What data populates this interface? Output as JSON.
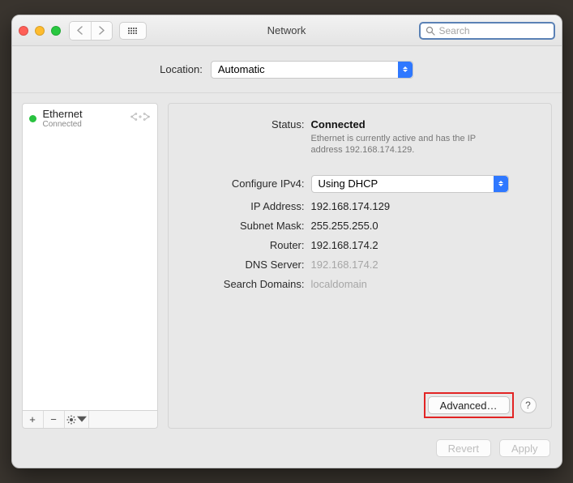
{
  "header": {
    "title": "Network",
    "search_placeholder": "Search"
  },
  "location": {
    "label": "Location:",
    "value": "Automatic"
  },
  "sidebar": {
    "items": [
      {
        "name": "Ethernet",
        "status": "Connected",
        "dot_color": "#29c240"
      }
    ]
  },
  "detail": {
    "status_label": "Status:",
    "status_value": "Connected",
    "status_description": "Ethernet is currently active and has the IP address 192.168.174.129.",
    "configure_label": "Configure IPv4:",
    "configure_value": "Using DHCP",
    "ip_label": "IP Address:",
    "ip_value": "192.168.174.129",
    "subnet_label": "Subnet Mask:",
    "subnet_value": "255.255.255.0",
    "router_label": "Router:",
    "router_value": "192.168.174.2",
    "dns_label": "DNS Server:",
    "dns_value": "192.168.174.2",
    "search_domains_label": "Search Domains:",
    "search_domains_value": "localdomain",
    "advanced_label": "Advanced…",
    "help": "?"
  },
  "footer": {
    "revert": "Revert",
    "apply": "Apply"
  },
  "icons": {
    "plus": "+",
    "minus": "−"
  }
}
